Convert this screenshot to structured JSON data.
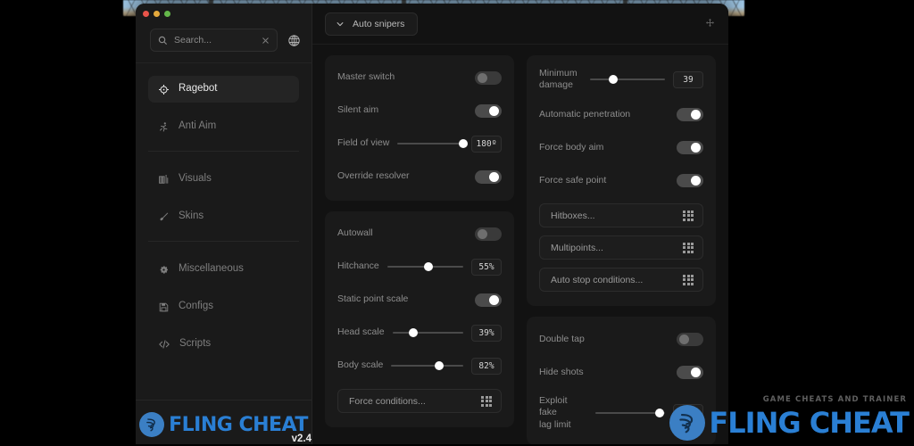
{
  "window": {
    "traffic_lights": [
      "close",
      "minimize",
      "maximize"
    ]
  },
  "sidebar": {
    "search": {
      "placeholder": "Search...",
      "value": "",
      "icon": "search-icon",
      "clear_icon": "close-icon"
    },
    "language_icon": "globe-icon",
    "items": [
      {
        "label": "Ragebot",
        "icon": "crosshair-icon",
        "active": true,
        "group": 0
      },
      {
        "label": "Anti Aim",
        "icon": "running-man-icon",
        "active": false,
        "group": 0
      },
      {
        "label": "Visuals",
        "icon": "visuals-icon",
        "active": false,
        "group": 1
      },
      {
        "label": "Skins",
        "icon": "brush-icon",
        "active": false,
        "group": 1
      },
      {
        "label": "Miscellaneous",
        "icon": "gear-icon",
        "active": false,
        "group": 2
      },
      {
        "label": "Configs",
        "icon": "save-icon",
        "active": false,
        "group": 2
      },
      {
        "label": "Scripts",
        "icon": "code-icon",
        "active": false,
        "group": 2
      }
    ],
    "brand": {
      "name": "FLING CHEAT",
      "version": "v2.4",
      "color": "#2a7fd4"
    }
  },
  "topbar": {
    "dropdown_label": "Auto snipers",
    "dropdown_icon": "chevron-down-icon",
    "move_icon": "move-cross-icon"
  },
  "panels": {
    "middle": [
      {
        "name": "ragebot-main-card",
        "rows": [
          {
            "type": "toggle",
            "label": "Master switch",
            "on": false
          },
          {
            "type": "toggle",
            "label": "Silent aim",
            "on": true
          },
          {
            "type": "slider",
            "label": "Field of view",
            "value": "180º",
            "percent": 100
          },
          {
            "type": "toggle",
            "label": "Override resolver",
            "on": true
          }
        ]
      },
      {
        "name": "ragebot-accuracy-card",
        "rows": [
          {
            "type": "toggle",
            "label": "Autowall",
            "on": false
          },
          {
            "type": "slider",
            "label": "Hitchance",
            "value": "55%",
            "percent": 55
          },
          {
            "type": "toggle",
            "label": "Static point scale",
            "on": true
          },
          {
            "type": "slider",
            "label": "Head scale",
            "value": "39%",
            "percent": 30
          },
          {
            "type": "slider",
            "label": "Body scale",
            "value": "82%",
            "percent": 66
          },
          {
            "type": "picker",
            "label": "Force conditions...",
            "icon": "grid-icon"
          }
        ]
      }
    ],
    "right": [
      {
        "name": "ragebot-target-card",
        "rows": [
          {
            "type": "slider",
            "label": "Minimum\ndamage",
            "value": "39",
            "percent": 31
          },
          {
            "type": "toggle",
            "label": "Automatic penetration",
            "on": true
          },
          {
            "type": "toggle",
            "label": "Force body aim",
            "on": true
          },
          {
            "type": "toggle",
            "label": "Force safe point",
            "on": true
          },
          {
            "type": "picker",
            "label": "Hitboxes...",
            "icon": "grid-icon"
          },
          {
            "type": "picker",
            "label": "Multipoints...",
            "icon": "grid-icon"
          },
          {
            "type": "picker",
            "label": "Auto stop conditions...",
            "icon": "grid-icon"
          }
        ]
      },
      {
        "name": "ragebot-exploits-card",
        "rows": [
          {
            "type": "toggle",
            "label": "Double tap",
            "on": false
          },
          {
            "type": "toggle",
            "label": "Hide shots",
            "on": true
          },
          {
            "type": "slider",
            "label": "Exploit fake\nlag limit",
            "value": "",
            "percent": 84
          }
        ]
      }
    ]
  },
  "watermark": {
    "tagline": "GAME CHEATS AND TRAINER",
    "name": "FLING CHEAT",
    "color": "#2a7fd4"
  }
}
